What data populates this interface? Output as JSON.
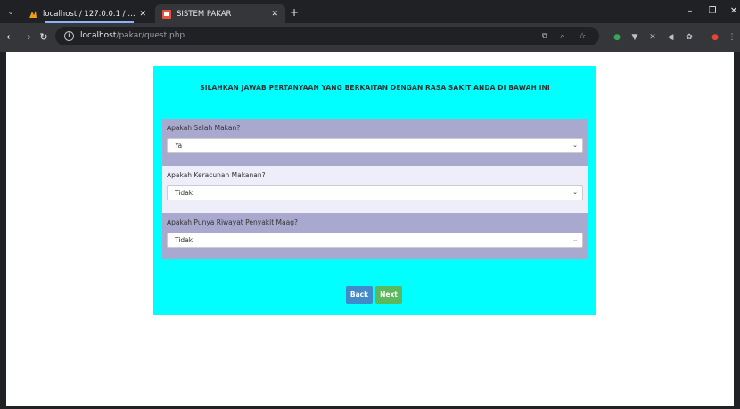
{
  "browser": {
    "tabs": [
      {
        "title": "localhost / 127.0.0.1 / pakar | p",
        "active": false
      },
      {
        "title": "SISTEM PAKAR",
        "active": true
      }
    ],
    "url_host": "localhost",
    "url_path": "/pakar/quest.php"
  },
  "page": {
    "title": "SILAHKAN JAWAB PERTANYAAN YANG BERKAITAN DENGAN RASA SAKIT ANDA DI BAWAH INI",
    "questions": [
      {
        "label": "Apakah Salah Makan?",
        "value": "Ya"
      },
      {
        "label": "Apakah Keracunan Makanan?",
        "value": "Tidak"
      },
      {
        "label": "Apakah Punya Riwayat Penyakit Maag?",
        "value": "Tidak"
      }
    ],
    "back_label": "Back",
    "next_label": "Next"
  },
  "colors": {
    "panel": "#00ffff",
    "question_odd": "#a9a9cf",
    "question_even": "#eeeefa",
    "back_button": "#428bca",
    "next_button": "#5cb85c"
  }
}
